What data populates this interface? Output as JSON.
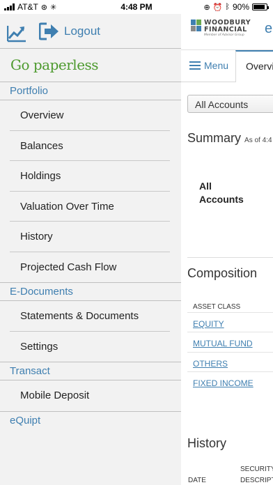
{
  "status": {
    "carrier": "AT&T",
    "time": "4:48 PM",
    "battery": "90%",
    "battery_level": 0.9
  },
  "sidebar": {
    "logout_label": "Logout",
    "paperless_label": "Go paperless",
    "portfolio_label": "Portfolio",
    "portfolio_items": [
      "Overview",
      "Balances",
      "Holdings",
      "Valuation Over Time",
      "History",
      "Projected Cash Flow"
    ],
    "edocs_label": "E-Documents",
    "edocs_items": [
      "Statements & Documents",
      "Settings"
    ],
    "transact_label": "Transact",
    "transact_items": [
      "Mobile Deposit"
    ],
    "equipt_label": "eQuipt"
  },
  "main": {
    "logo_line1": "WOODBURY",
    "logo_line2": "FINANCIAL",
    "logo_line3": "Member of Advisor Group",
    "e_partial": "e",
    "menu_label": "Menu",
    "tab_overview": "Overvi",
    "account_select": "All Accounts",
    "summary_title": "Summary",
    "summary_asof": "As of 4:4",
    "all_accounts": "All Accounts",
    "composition_title": "Composition",
    "asset_class_header": "ASSET CLASS",
    "asset_classes": [
      "EQUITY",
      "MUTUAL FUND",
      "OTHERS",
      "FIXED INCOME"
    ],
    "history_title": "History",
    "history_security": "SECURITY",
    "history_descript": "DESCRIPT",
    "history_date": "DATE"
  },
  "colors": {
    "accent": "#3f7fb0",
    "paperless_green": "#4d9a2e",
    "sidebar_bg": "#f2f2f2"
  }
}
